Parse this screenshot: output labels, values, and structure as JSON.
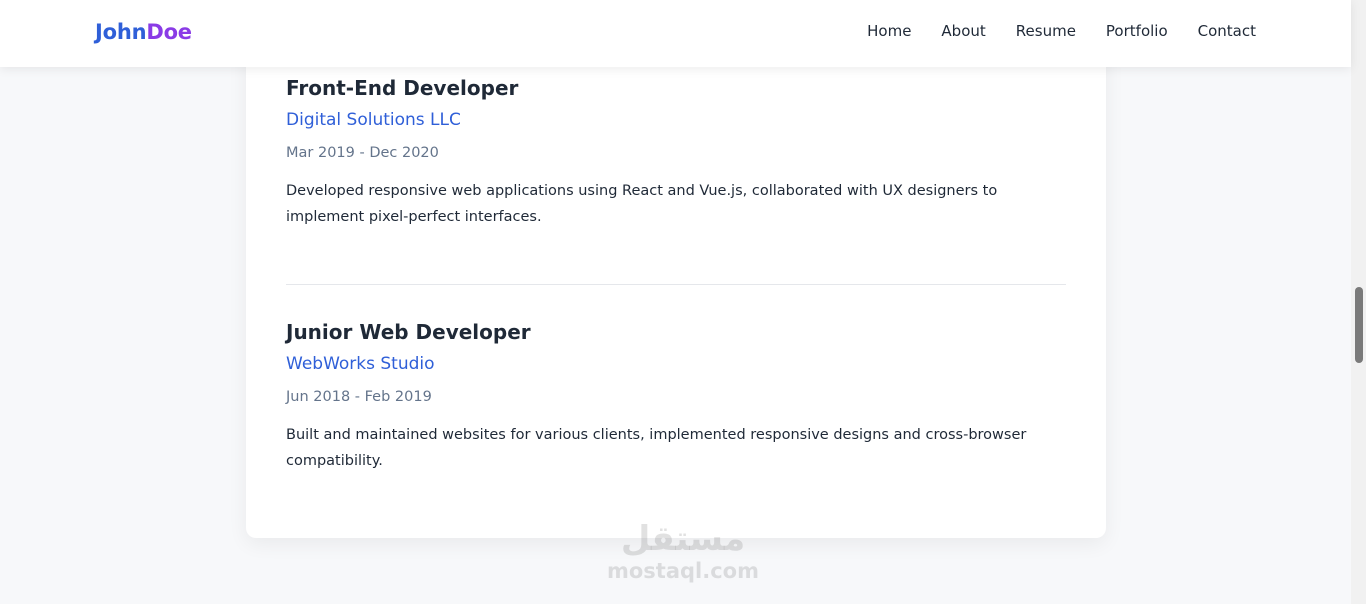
{
  "header": {
    "logo": {
      "first": "John",
      "second": "Doe"
    },
    "nav": [
      "Home",
      "About",
      "Resume",
      "Portfolio",
      "Contact"
    ]
  },
  "experience": [
    {
      "title": "Front-End Developer",
      "company": "Digital Solutions LLC",
      "dates": "Mar 2019 - Dec 2020",
      "description": "Developed responsive web applications using React and Vue.js, collaborated with UX designers to implement pixel-perfect interfaces."
    },
    {
      "title": "Junior Web Developer",
      "company": "WebWorks Studio",
      "dates": "Jun 2018 - Feb 2019",
      "description": "Built and maintained websites for various clients, implemented responsive designs and cross-browser compatibility."
    }
  ],
  "watermark": {
    "arabic": "مستقل",
    "latin": "mostaql.com"
  },
  "colors": {
    "brand_blue": "#2f5fd8",
    "brand_purple": "#8a3be6",
    "page_bg": "#f7f8fa",
    "muted_text": "#64748b"
  }
}
